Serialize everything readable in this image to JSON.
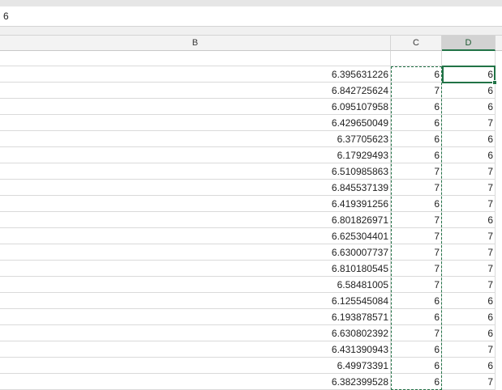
{
  "formula_bar": {
    "value": "6"
  },
  "columns": [
    {
      "label": "B",
      "selected": false
    },
    {
      "label": "C",
      "selected": false
    },
    {
      "label": "D",
      "selected": true
    }
  ],
  "rows": [
    {
      "b": "",
      "c": "",
      "d": ""
    },
    {
      "b": "6.395631226",
      "c": "6",
      "d": "6"
    },
    {
      "b": "6.842725624",
      "c": "7",
      "d": "6"
    },
    {
      "b": "6.095107958",
      "c": "6",
      "d": "6"
    },
    {
      "b": "6.429650049",
      "c": "6",
      "d": "7"
    },
    {
      "b": "6.37705623",
      "c": "6",
      "d": "6"
    },
    {
      "b": "6.17929493",
      "c": "6",
      "d": "6"
    },
    {
      "b": "6.510985863",
      "c": "7",
      "d": "7"
    },
    {
      "b": "6.845537139",
      "c": "7",
      "d": "7"
    },
    {
      "b": "6.419391256",
      "c": "6",
      "d": "7"
    },
    {
      "b": "6.801826971",
      "c": "7",
      "d": "6"
    },
    {
      "b": "6.625304401",
      "c": "7",
      "d": "7"
    },
    {
      "b": "6.630007737",
      "c": "7",
      "d": "7"
    },
    {
      "b": "6.810180545",
      "c": "7",
      "d": "7"
    },
    {
      "b": "6.58481005",
      "c": "7",
      "d": "7"
    },
    {
      "b": "6.125545084",
      "c": "6",
      "d": "6"
    },
    {
      "b": "6.193878571",
      "c": "6",
      "d": "6"
    },
    {
      "b": "6.630802392",
      "c": "7",
      "d": "6"
    },
    {
      "b": "6.431390943",
      "c": "6",
      "d": "7"
    },
    {
      "b": "6.49973391",
      "c": "6",
      "d": "6"
    },
    {
      "b": "6.382399528",
      "c": "6",
      "d": "7"
    }
  ],
  "colors": {
    "accent": "#217346",
    "gridline": "#dadada",
    "header_bg": "#f3f3f3"
  }
}
